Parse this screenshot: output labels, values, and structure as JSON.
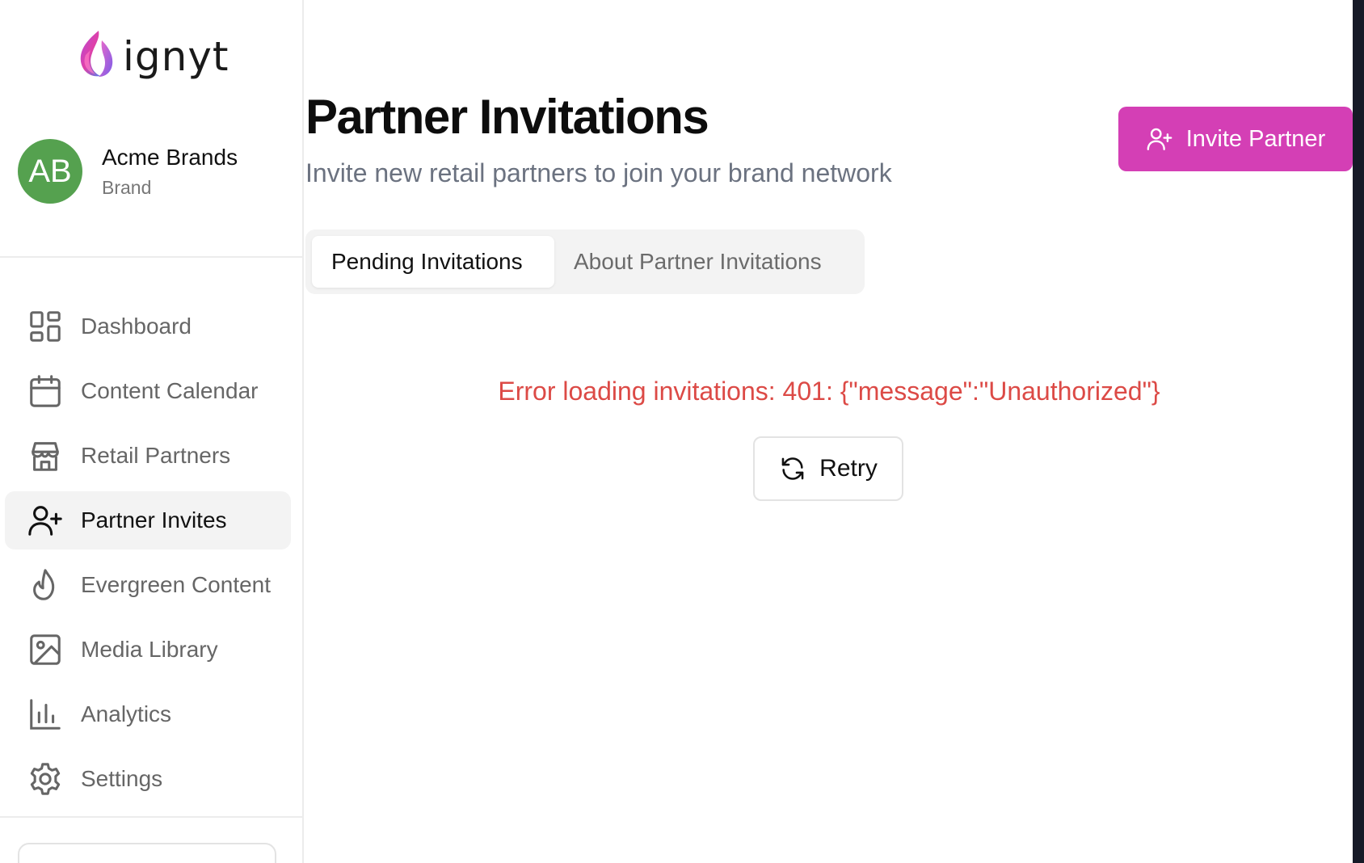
{
  "brand": {
    "logo_text": "ignyt"
  },
  "profile": {
    "initials": "AB",
    "name": "Acme Brands",
    "role": "Brand",
    "avatar_color": "#55a14f"
  },
  "sidebar": {
    "items": [
      {
        "label": "Dashboard",
        "icon": "grid-icon",
        "active": false
      },
      {
        "label": "Content Calendar",
        "icon": "calendar-icon",
        "active": false
      },
      {
        "label": "Retail Partners",
        "icon": "store-icon",
        "active": false
      },
      {
        "label": "Partner Invites",
        "icon": "user-plus-icon",
        "active": true
      },
      {
        "label": "Evergreen Content",
        "icon": "flame-icon",
        "active": false
      },
      {
        "label": "Media Library",
        "icon": "image-icon",
        "active": false
      },
      {
        "label": "Analytics",
        "icon": "bar-chart-icon",
        "active": false
      },
      {
        "label": "Settings",
        "icon": "gear-icon",
        "active": false
      }
    ]
  },
  "header": {
    "title": "Partner Invitations",
    "subtitle": "Invite new retail partners to join your brand network",
    "invite_button": "Invite Partner"
  },
  "tabs": [
    {
      "label": "Pending Invitations",
      "active": true
    },
    {
      "label": "About Partner Invitations",
      "active": false
    }
  ],
  "status": {
    "error_message": "Error loading invitations: 401: {\"message\":\"Unauthorized\"}",
    "retry_label": "Retry"
  },
  "colors": {
    "accent": "#d43fb5",
    "error": "#dc4a46",
    "muted_text": "#6b7280"
  }
}
